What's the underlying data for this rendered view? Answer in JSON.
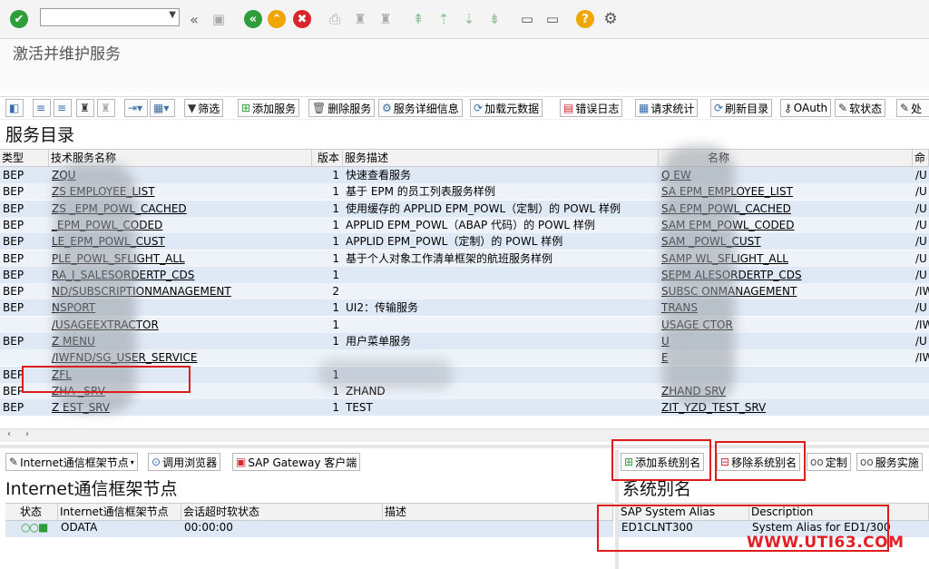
{
  "toolbar": {
    "command_field_value": "",
    "icons": [
      "check-icon",
      "back-icon",
      "save-icon",
      "prev-screen-icon",
      "exit-icon",
      "cancel-icon",
      "print-icon",
      "find-icon",
      "find-next-icon",
      "first-page-icon",
      "prev-page-icon",
      "next-page-icon",
      "last-page-icon",
      "new-session-icon",
      "shortcut-icon",
      "help-icon",
      "settings-icon"
    ]
  },
  "page": {
    "title": "激活并维护服务"
  },
  "app_toolbar": {
    "filter": "筛选",
    "add_service": "添加服务",
    "delete_service": "删除服务",
    "service_details": "服务详细信息",
    "load_metadata": "加载元数据",
    "error_log": "错误日志",
    "request_stats": "请求统计",
    "refresh_catalog": "刷新目录",
    "oauth": "OAuth",
    "soft_state": "软状态",
    "process": "处"
  },
  "catalog": {
    "title": "服务目录",
    "headers": {
      "type": "类型",
      "tech_name": "技术服务名称",
      "version": "版本",
      "desc": "服务描述",
      "ext_name": "名称",
      "ns": "命"
    },
    "rows": [
      {
        "type": "BEP",
        "tech": "ZQU",
        "ver": "1",
        "desc": "快速查看服务",
        "ext": "Q         EW",
        "ns": "/U"
      },
      {
        "type": "BEP",
        "tech": "ZS          EMPLOYEE_LIST",
        "ver": "1",
        "desc": "基于 EPM 的员工列表服务样例",
        "ext": "SA      EPM_EMPLOYEE_LIST",
        "ns": "/U"
      },
      {
        "type": "BEP",
        "tech": "ZS       _EPM_POWL_CACHED",
        "ver": "1",
        "desc": "使用缓存的 APPLID EPM_POWL（定制）的 POWL 样例",
        "ext": "SA       EPM_POWL_CACHED",
        "ns": "/U"
      },
      {
        "type": "BEP",
        "tech": "       _EPM_POWL_CODED",
        "ver": "1",
        "desc": "APPLID EPM_POWL（ABAP 代码）的 POWL 样例",
        "ext": "SAM       EPM_POWL_CODED",
        "ns": "/U"
      },
      {
        "type": "BEP",
        "tech": "       LE_EPM_POWL_CUST",
        "ver": "1",
        "desc": "APPLID EPM_POWL（定制）的 POWL 样例",
        "ext": "SAM      _POWL_CUST",
        "ns": "/U"
      },
      {
        "type": "BEP",
        "tech": "       PLE_POWL_SFLIGHT_ALL",
        "ver": "1",
        "desc": "基于个人对象工作清单框架的航班服务样例",
        "ext": "SAMP      WL_SFLIGHT_ALL",
        "ns": "/U"
      },
      {
        "type": "BEP",
        "tech": "       RA_I_SALESORDERTP_CDS",
        "ver": "1",
        "desc": "",
        "ext": "SEPM      ALESORDERTP_CDS",
        "ns": "/U"
      },
      {
        "type": "BEP",
        "tech": "       ND/SUBSCRIPTIONMANAGEMENT",
        "ver": "2",
        "desc": "",
        "ext": "SUBSC        ONMANAGEMENT",
        "ns": "/IW"
      },
      {
        "type": "BEP",
        "tech": "       NSPORT",
        "ver": "1",
        "desc": "UI2：传输服务",
        "ext": "TRANS",
        "ns": "/U"
      },
      {
        "type": "",
        "tech": "       /USAGEEXTRACTOR",
        "ver": "1",
        "desc": "",
        "ext": "USAGE       CTOR",
        "ns": "/IW"
      },
      {
        "type": "BEP",
        "tech": "Z      MENU",
        "ver": "1",
        "desc": "用户菜单服务",
        "ext": "U",
        "ns": "/U"
      },
      {
        "type": "",
        "tech": "/IWFND/SG_USER_SERVICE",
        "ver": "",
        "desc": "",
        "ext": "E",
        "ns": "/IW"
      },
      {
        "type": "BEP",
        "tech": "ZFL",
        "ver": "1",
        "desc": "",
        "ext": "",
        "ns": ""
      },
      {
        "type": "BEP",
        "tech": "ZHA       _SRV",
        "ver": "1",
        "desc": "ZHAND",
        "ext": "ZHAND      SRV",
        "ns": ""
      },
      {
        "type": "BEP",
        "tech": "Z       EST_SRV",
        "ver": "1",
        "desc": "TEST",
        "ext": "ZIT_YZD_TEST_SRV",
        "ns": ""
      }
    ]
  },
  "icf": {
    "toolbar": {
      "icf_node": "Internet通信框架节点",
      "call_browser": "调用浏览器",
      "gw_client": "SAP Gateway 客户端"
    },
    "title": "Internet通信框架节点",
    "headers": {
      "status": "状态",
      "node": "Internet通信框架节点",
      "timeout": "会话超时软状态",
      "desc": "描述"
    },
    "rows": [
      {
        "status": "○○■",
        "node": "ODATA",
        "timeout": "00:00:00",
        "desc": ""
      }
    ]
  },
  "alias": {
    "toolbar": {
      "add": "添加系统别名",
      "remove": "移除系统别名",
      "custom": "定制",
      "impl": "服务实施"
    },
    "title": "系统别名",
    "headers": {
      "alias": "SAP System Alias",
      "desc": "Description"
    },
    "rows": [
      {
        "alias": "ED1CLNT300",
        "desc": "System Alias for ED1/300"
      }
    ]
  },
  "watermark": "WWW.UTI63.COM",
  "colors": {
    "accent_red": "#e01b1b",
    "row_blue": "#dfe8f5",
    "check_green": "#2e9d3a"
  }
}
